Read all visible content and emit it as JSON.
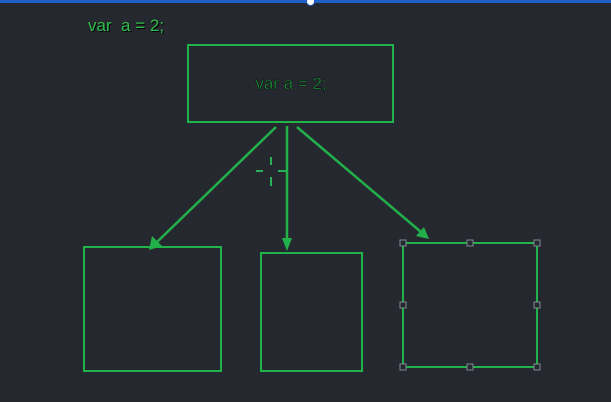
{
  "canvas": {
    "code_label": "var  a = 2;",
    "root_box_text": "var a = 2;"
  },
  "colors": {
    "background": "#262830",
    "accent_green": "#22b04a",
    "top_bar_blue": "#1f5fc8"
  }
}
